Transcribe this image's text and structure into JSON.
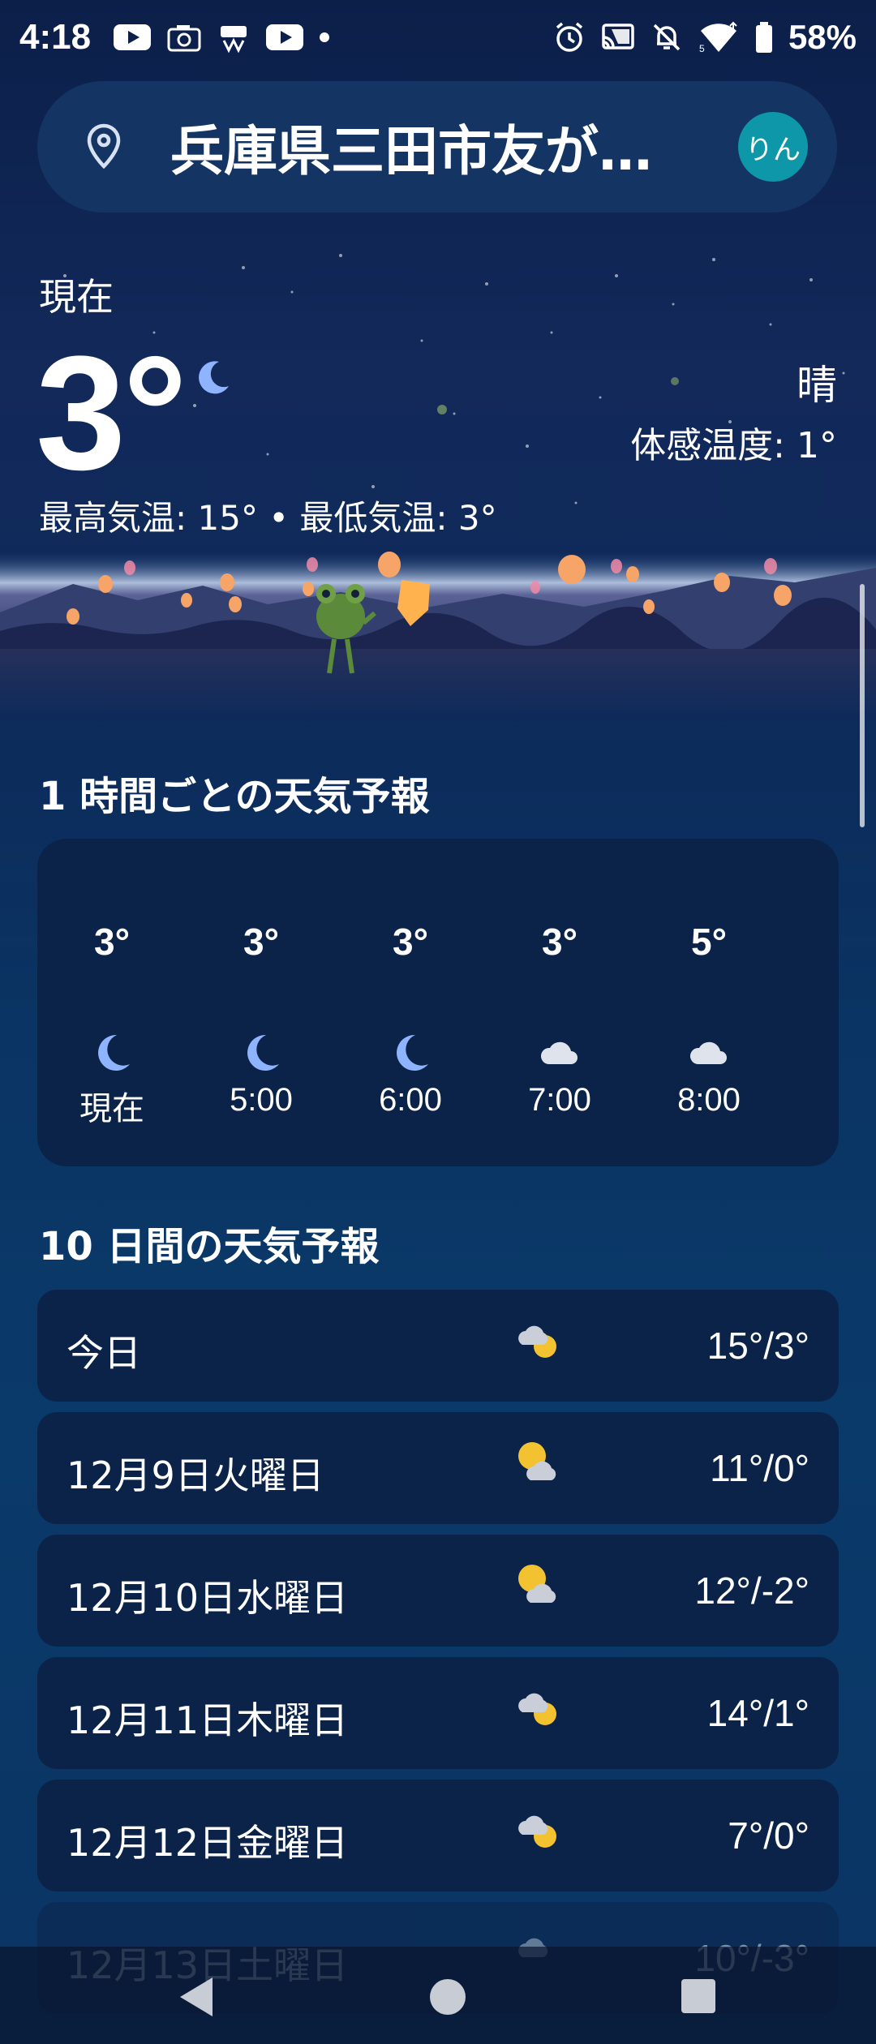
{
  "status": {
    "time": "4:18",
    "battery": "58%"
  },
  "search": {
    "location": "兵庫県三田市友が…",
    "avatar": "りん"
  },
  "current": {
    "label": "現在",
    "temp": "3°",
    "condition": "晴",
    "feels_like": "体感温度: 1°",
    "hilo": "最高気温: 15° • 最低気温: 3°"
  },
  "hourly": {
    "title": "1 時間ごとの天気予報",
    "items": [
      {
        "temp": "3°",
        "time": "現在",
        "icon": "moon-icon"
      },
      {
        "temp": "3°",
        "time": "5:00",
        "icon": "moon-icon"
      },
      {
        "temp": "3°",
        "time": "6:00",
        "icon": "moon-icon"
      },
      {
        "temp": "3°",
        "time": "7:00",
        "icon": "cloud-icon"
      },
      {
        "temp": "5°",
        "time": "8:00",
        "icon": "cloud-icon"
      }
    ]
  },
  "daily": {
    "title": "10 日間の天気予報",
    "items": [
      {
        "day": "今日",
        "temp": "15°/3°",
        "icon": "cloud-sun-icon"
      },
      {
        "day": "12月9日火曜日",
        "temp": "11°/0°",
        "icon": "sun-cloud-icon"
      },
      {
        "day": "12月10日水曜日",
        "temp": "12°/-2°",
        "icon": "sun-cloud-icon"
      },
      {
        "day": "12月11日木曜日",
        "temp": "14°/1°",
        "icon": "cloud-sun-icon"
      },
      {
        "day": "12月12日金曜日",
        "temp": "7°/0°",
        "icon": "cloud-sun-icon"
      },
      {
        "day": "12月13日土曜日",
        "temp": "10°/-3°",
        "icon": "cloud-icon"
      }
    ]
  },
  "colors": {
    "background": "#0a3463",
    "card": "#0b2348",
    "avatar": "#0e97a8",
    "moon": "#8fb4ff",
    "sun": "#f2c230"
  }
}
